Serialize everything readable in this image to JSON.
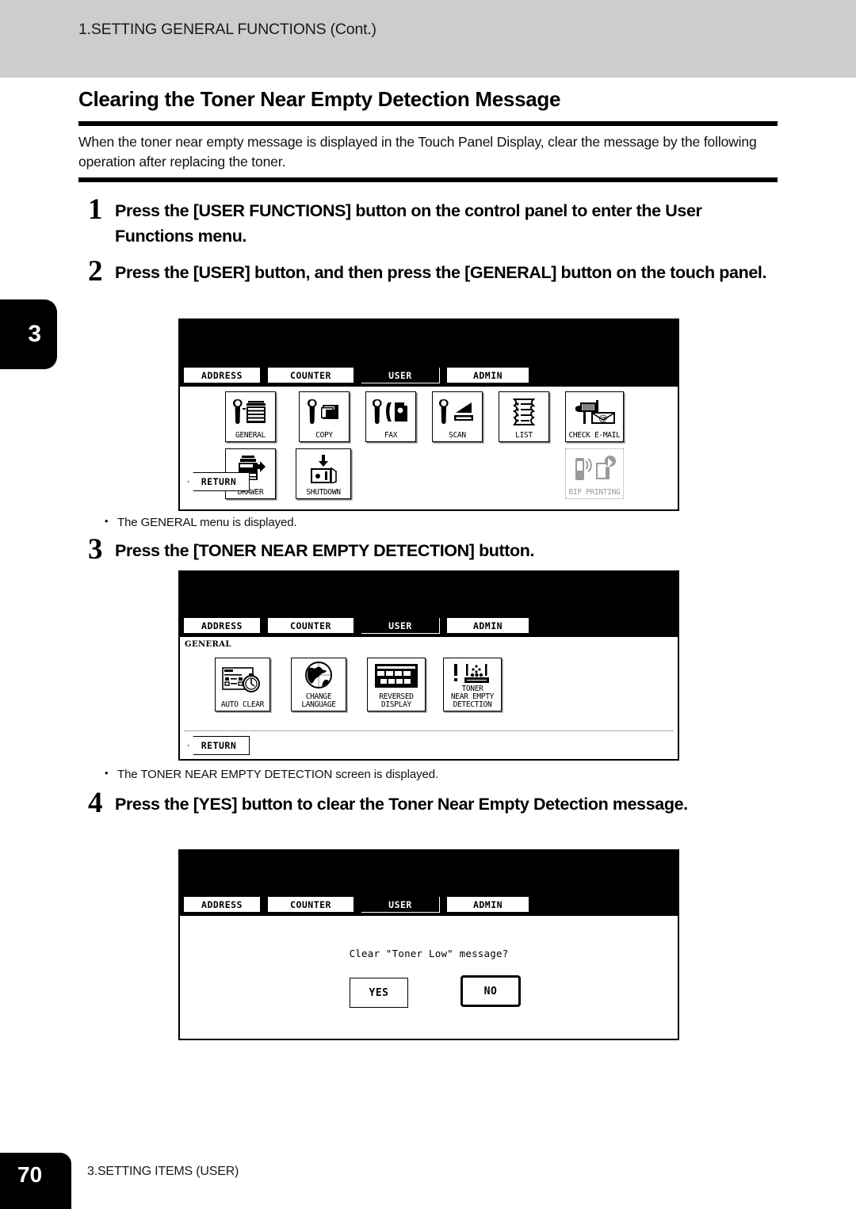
{
  "header": {
    "running_head": "1.SETTING GENERAL FUNCTIONS (Cont.)"
  },
  "chapter_tab": {
    "number": "3"
  },
  "section": {
    "title": "Clearing the Toner Near Empty Detection Message",
    "intro": "When the toner near empty message is displayed in the Touch Panel Display, clear the message by the following operation after replacing the toner."
  },
  "steps": [
    {
      "num": "1",
      "text": "Press the [USER FUNCTIONS] button on the control panel to enter the User Functions menu."
    },
    {
      "num": "2",
      "text": "Press the [USER] button, and then press the [GENERAL] button on the touch panel."
    },
    {
      "num": "3",
      "text": "Press the [TONER NEAR EMPTY DETECTION] button."
    },
    {
      "num": "4",
      "text": "Press the [YES] button to clear the Toner Near Empty Detection message."
    }
  ],
  "captions": [
    {
      "text": "The GENERAL menu is displayed."
    },
    {
      "text": "The TONER NEAR EMPTY DETECTION screen is displayed."
    }
  ],
  "tabs": {
    "address": "ADDRESS",
    "counter": "COUNTER",
    "user": "USER",
    "admin": "ADMIN",
    "active": "USER"
  },
  "panel_user": {
    "return_label": "RETURN",
    "keys": [
      {
        "label": "GENERAL",
        "icon": "wrench-copier-icon",
        "disabled": false
      },
      {
        "label": "COPY",
        "icon": "wrench-page-icon",
        "disabled": false
      },
      {
        "label": "FAX",
        "icon": "wrench-fax-icon",
        "disabled": false
      },
      {
        "label": "SCAN",
        "icon": "wrench-scanner-icon",
        "disabled": false
      },
      {
        "label": "LIST",
        "icon": "document-list-icon",
        "disabled": false
      },
      {
        "label": "CHECK E-MAIL",
        "icon": "mailbox-at-icon",
        "disabled": false
      },
      {
        "label": "DRAWER",
        "icon": "drawer-copier-icon",
        "disabled": false
      },
      {
        "label": "SHUTDOWN",
        "icon": "power-switch-icon",
        "disabled": false
      },
      {
        "label": "BIP PRINTING",
        "icon": "bluetooth-phone-print-icon",
        "disabled": true
      }
    ]
  },
  "panel_general": {
    "breadcrumb": "GENERAL",
    "return_label": "RETURN",
    "keys": [
      {
        "label": "AUTO CLEAR",
        "icon": "window-stopwatch-icon"
      },
      {
        "label": "CHANGE\nLANGUAGE",
        "icon": "globe-icon"
      },
      {
        "label": "REVERSED\nDISPLAY",
        "icon": "inverted-panel-icon"
      },
      {
        "label": "TONER\nNEAR EMPTY\nDETECTION",
        "icon": "toner-empty-icon"
      }
    ]
  },
  "panel_confirm": {
    "message": "Clear \"Toner Low\" message?",
    "yes_label": "YES",
    "no_label": "NO"
  },
  "footer": {
    "page_number": "70",
    "chapter": "3.SETTING ITEMS (USER)"
  },
  "colors": {
    "header_band": "#cdcdcd",
    "ink": "#000000",
    "paper": "#ffffff",
    "disabled": "#9a9a9a"
  }
}
